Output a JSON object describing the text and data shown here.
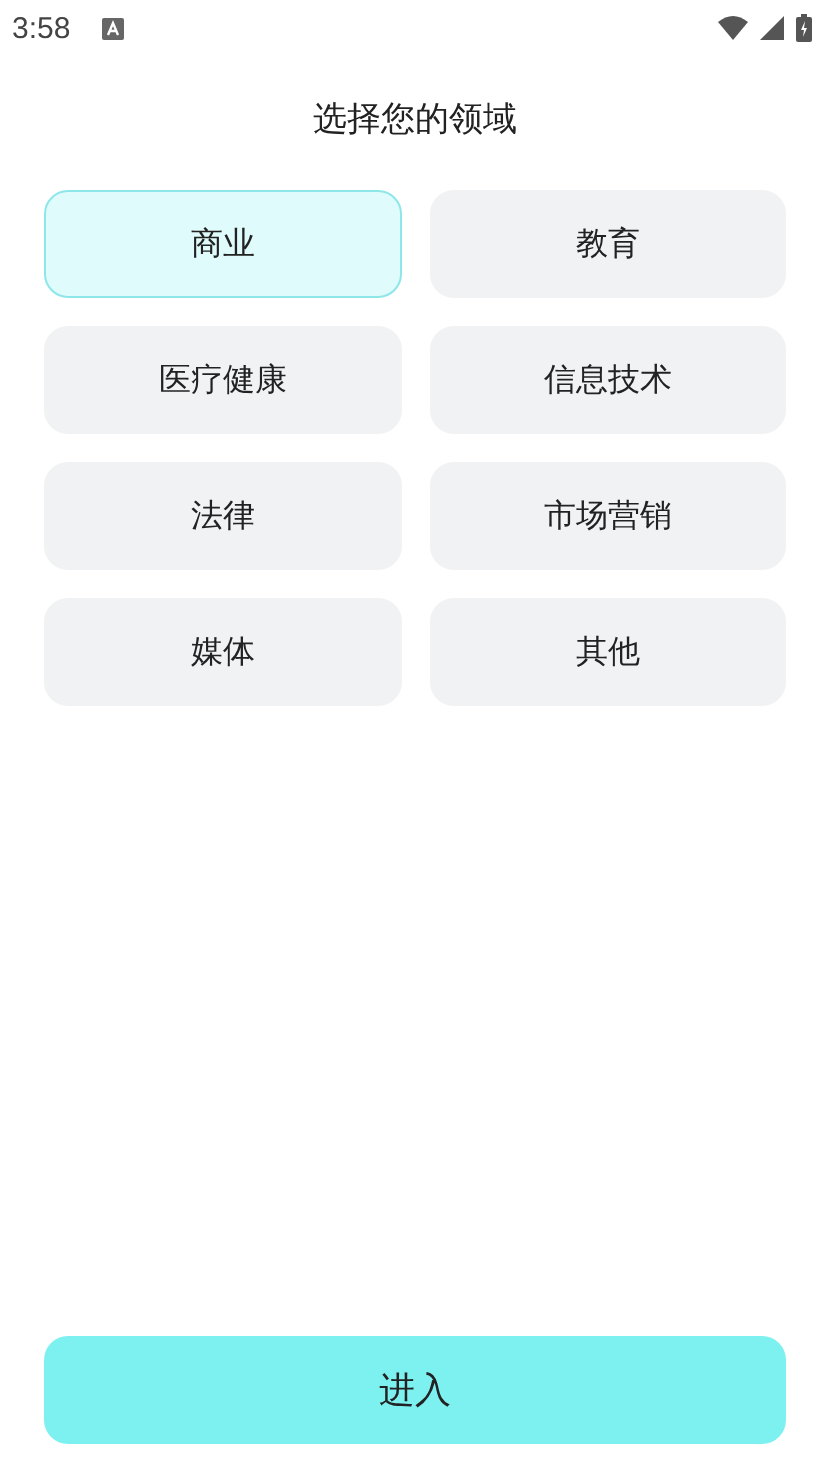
{
  "status_bar": {
    "time": "3:58"
  },
  "title": "选择您的领域",
  "fields": [
    {
      "label": "商业",
      "selected": true
    },
    {
      "label": "教育",
      "selected": false
    },
    {
      "label": "医疗健康",
      "selected": false
    },
    {
      "label": "信息技术",
      "selected": false
    },
    {
      "label": "法律",
      "selected": false
    },
    {
      "label": "市场营销",
      "selected": false
    },
    {
      "label": "媒体",
      "selected": false
    },
    {
      "label": "其他",
      "selected": false
    }
  ],
  "enter_button": {
    "label": "进入"
  }
}
